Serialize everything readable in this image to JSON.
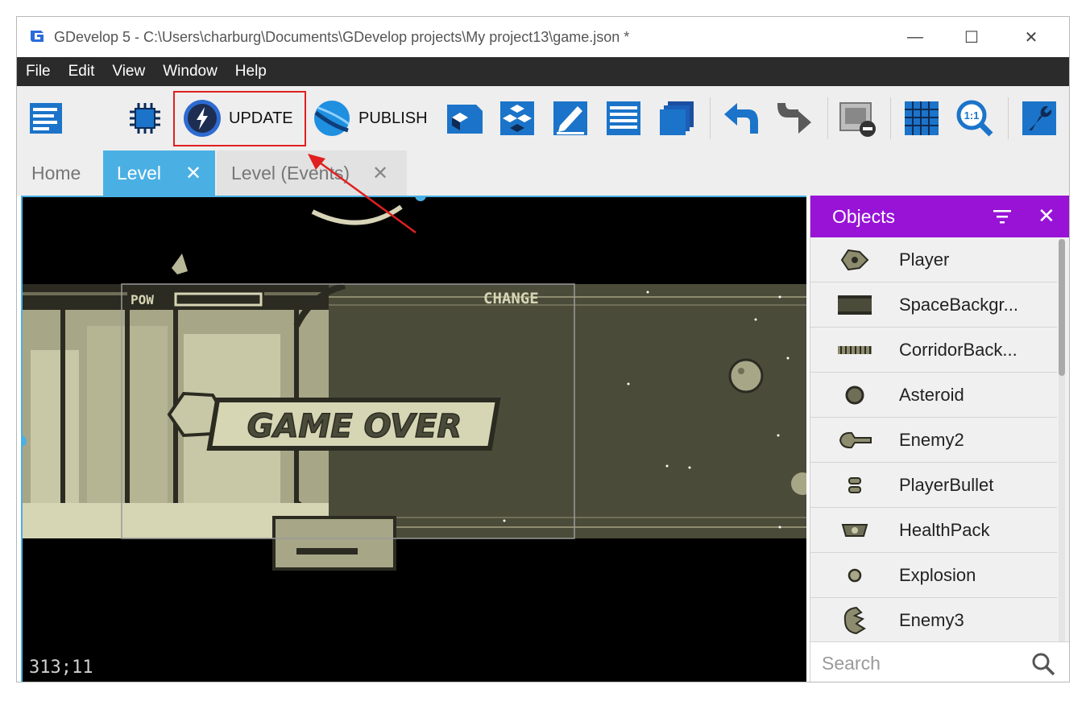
{
  "titlebar": {
    "title": "GDevelop 5 - C:\\Users\\charburg\\Documents\\GDevelop projects\\My project13\\game.json *",
    "app_icon": "gdevelop-logo-icon",
    "minimize": "—",
    "maximize": "☐",
    "close": "✕"
  },
  "menu": [
    "File",
    "Edit",
    "View",
    "Window",
    "Help"
  ],
  "toolbar": {
    "update_label": "UPDATE",
    "publish_label": "PUBLISH",
    "icons": [
      "project-manager-icon",
      "debugger-icon",
      "update-icon",
      "publish-icon",
      "object-groups-icon",
      "layers-icon",
      "properties-edit-icon",
      "instances-list-icon",
      "layers-stack-icon",
      "undo-icon",
      "redo-icon",
      "preview-disabled-icon",
      "grid-icon",
      "zoom-reset-icon",
      "preferences-wrench-icon"
    ],
    "highlight_color": "#e02020"
  },
  "tabs": [
    {
      "label": "Home",
      "active": false,
      "closable": false
    },
    {
      "label": "Level",
      "active": true,
      "closable": true
    },
    {
      "label": "Level (Events)",
      "active": false,
      "closable": true
    }
  ],
  "canvas": {
    "cursor_coords": "313;11",
    "hud_pow": "POW",
    "hud_change": "CHANGE",
    "game_over_text": "GAME OVER"
  },
  "objects_panel": {
    "title": "Objects",
    "accent": "#9813d6",
    "items": [
      {
        "name": "Player",
        "icon": "player-ship-icon"
      },
      {
        "name": "SpaceBackgr...",
        "icon": "space-background-icon"
      },
      {
        "name": "CorridorBack...",
        "icon": "corridor-background-icon"
      },
      {
        "name": "Asteroid",
        "icon": "asteroid-icon"
      },
      {
        "name": "Enemy2",
        "icon": "enemy2-icon"
      },
      {
        "name": "PlayerBullet",
        "icon": "player-bullet-icon"
      },
      {
        "name": "HealthPack",
        "icon": "health-pack-icon"
      },
      {
        "name": "Explosion",
        "icon": "explosion-icon"
      },
      {
        "name": "Enemy3",
        "icon": "enemy3-icon"
      }
    ],
    "search_placeholder": "Search"
  }
}
